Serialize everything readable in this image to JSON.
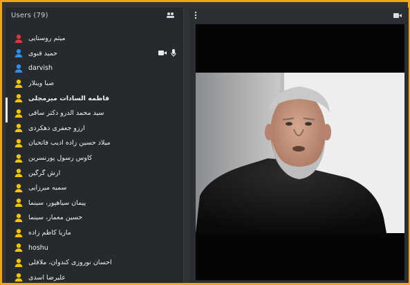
{
  "users_panel": {
    "title": "Users (79)",
    "header_icon": "users-group-icon",
    "users": [
      {
        "name": "میثم روستایی",
        "role": "moderator",
        "color": "#d83a3a",
        "bold": false,
        "media": []
      },
      {
        "name": "حمید قنوی",
        "role": "presenter",
        "color": "#2f8fe8",
        "bold": false,
        "media": [
          "camera-icon",
          "microphone-icon"
        ]
      },
      {
        "name": "darvish",
        "role": "presenter",
        "color": "#2f8fe8",
        "bold": false,
        "media": []
      },
      {
        "name": "صبا وینلار",
        "role": "viewer",
        "color": "#f2c400",
        "bold": false,
        "media": []
      },
      {
        "name": "فاطمه السادات میرمجلی",
        "role": "viewer",
        "color": "#f2c400",
        "bold": true,
        "media": []
      },
      {
        "name": "سید محمد الدرو دکتر ساقی",
        "role": "viewer",
        "color": "#f2c400",
        "bold": false,
        "media": []
      },
      {
        "name": "آرزو جعفری دهکردی",
        "role": "viewer",
        "color": "#f2c400",
        "bold": false,
        "media": []
      },
      {
        "name": "میلاد حسین زاده ادیب فاتحیان",
        "role": "viewer",
        "color": "#f2c400",
        "bold": false,
        "media": []
      },
      {
        "name": "کاوس رسول پورنسرین",
        "role": "viewer",
        "color": "#f2c400",
        "bold": false,
        "media": []
      },
      {
        "name": "آرش گرگین",
        "role": "viewer",
        "color": "#f2c400",
        "bold": false,
        "media": []
      },
      {
        "name": "سمیه میرزایی",
        "role": "viewer",
        "color": "#f2c400",
        "bold": false,
        "media": []
      },
      {
        "name": "پیمان سیاهپور، سینما",
        "role": "viewer",
        "color": "#f2c400",
        "bold": false,
        "media": []
      },
      {
        "name": "حسین معمار، سینما",
        "role": "viewer",
        "color": "#f2c400",
        "bold": false,
        "media": []
      },
      {
        "name": "ماریا کاظم زاده",
        "role": "viewer",
        "color": "#f2c400",
        "bold": false,
        "media": []
      },
      {
        "name": "hoshu",
        "role": "viewer",
        "color": "#f2c400",
        "bold": false,
        "media": []
      },
      {
        "name": "احسان نوروزی کندوان، ملافلی",
        "role": "viewer",
        "color": "#f2c400",
        "bold": false,
        "media": []
      },
      {
        "name": "علیرضا اسدی",
        "role": "viewer",
        "color": "#f2c400",
        "bold": false,
        "media": []
      }
    ]
  },
  "video_panel": {
    "menu_icon": "more-vertical-icon",
    "camera_icon": "camera-icon"
  },
  "colors": {
    "frame_border": "#f3a712",
    "panel_bg": "#262a2f",
    "video_bg": "#050505"
  }
}
